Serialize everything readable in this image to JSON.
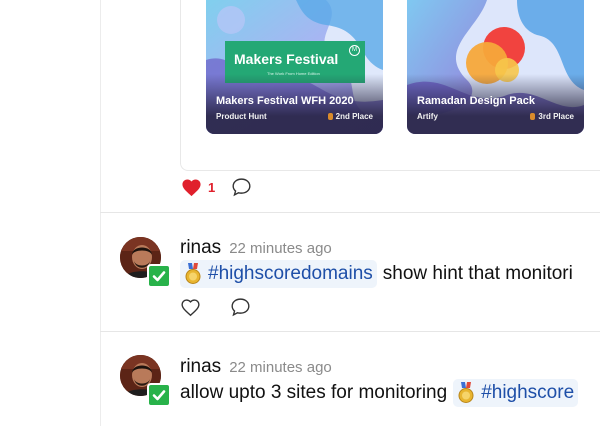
{
  "colors": {
    "like_red": "#e0202c",
    "hashtag_bg": "#eef4fb",
    "hashtag_text": "#1e4fa8",
    "verified_green": "#28b24a",
    "banner_green": "#24a875"
  },
  "embed": {
    "cards": [
      {
        "title": "Makers Festival WFH 2020",
        "source": "Product Hunt",
        "place": "2nd Place",
        "banner_title": "Makers Festival",
        "banner_badge": "M",
        "banner_subtitle": "The Work From Home Edition"
      },
      {
        "title": "Ramadan Design Pack",
        "source": "Artify",
        "place": "3rd Place"
      }
    ],
    "actions": {
      "like_count": "1",
      "liked": true,
      "heart_icon": "heart-filled-icon",
      "comment_icon": "comment-icon"
    }
  },
  "posts": [
    {
      "username": "rinas",
      "timestamp": "22 minutes ago",
      "hashtag": "#highscoredomains",
      "text_after": "show hint that monitori",
      "verified_icon": "check-icon",
      "medal_icon": "medal-icon",
      "heart_icon": "heart-outline-icon",
      "comment_icon": "comment-icon"
    },
    {
      "username": "rinas",
      "timestamp": "22 minutes ago",
      "text_before": "allow upto 3 sites for monitoring",
      "hashtag": "#highscore",
      "verified_icon": "check-icon",
      "medal_icon": "medal-icon"
    }
  ]
}
